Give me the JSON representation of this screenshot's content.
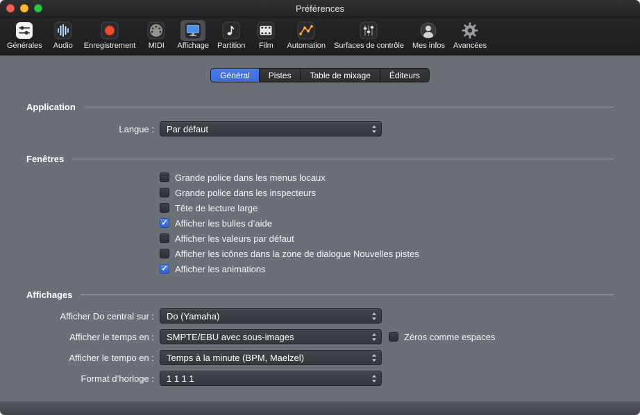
{
  "colors": {
    "accent": "#3d6cd8",
    "content-bg": "#6a6f78",
    "record-red": "#e8502e",
    "display-blue": "#4a8fe8",
    "automation-orange": "#f0a030"
  },
  "window": {
    "title": "Préférences"
  },
  "toolbar": {
    "items": [
      {
        "label": "Générales",
        "selected": false
      },
      {
        "label": "Audio",
        "selected": false
      },
      {
        "label": "Enregistrement",
        "selected": false
      },
      {
        "label": "MIDI",
        "selected": false
      },
      {
        "label": "Affichage",
        "selected": true
      },
      {
        "label": "Partition",
        "selected": false
      },
      {
        "label": "Film",
        "selected": false
      },
      {
        "label": "Automation",
        "selected": false
      },
      {
        "label": "Surfaces de contrôle",
        "selected": false
      },
      {
        "label": "Mes infos",
        "selected": false
      },
      {
        "label": "Avancées",
        "selected": false
      }
    ]
  },
  "tabs": [
    {
      "label": "Général",
      "selected": true
    },
    {
      "label": "Pistes",
      "selected": false
    },
    {
      "label": "Table de mixage",
      "selected": false
    },
    {
      "label": "Éditeurs",
      "selected": false
    }
  ],
  "sections": {
    "application": {
      "title": "Application",
      "language_label": "Langue :",
      "language_value": "Par défaut"
    },
    "windows": {
      "title": "Fenêtres",
      "checkboxes": [
        {
          "label": "Grande police dans les menus locaux",
          "checked": false
        },
        {
          "label": "Grande police dans les inspecteurs",
          "checked": false
        },
        {
          "label": "Tête de lecture large",
          "checked": false
        },
        {
          "label": "Afficher les bulles d’aide",
          "checked": true
        },
        {
          "label": "Afficher les valeurs par défaut",
          "checked": false
        },
        {
          "label": "Afficher les icônes dans la zone de dialogue Nouvelles pistes",
          "checked": false
        },
        {
          "label": "Afficher les animations",
          "checked": true
        }
      ]
    },
    "displays": {
      "title": "Affichages",
      "rows": [
        {
          "label": "Afficher Do central sur :",
          "value": "Do (Yamaha)"
        },
        {
          "label": "Afficher le temps en :",
          "value": "SMPTE/EBU avec sous-images"
        },
        {
          "label": "Afficher le tempo en :",
          "value": "Temps à la minute (BPM, Maelzel)"
        },
        {
          "label": "Format d’horloge :",
          "value": "1 1 1 1"
        }
      ],
      "zeros_checkbox": {
        "label": "Zéros comme espaces",
        "checked": false
      }
    }
  }
}
